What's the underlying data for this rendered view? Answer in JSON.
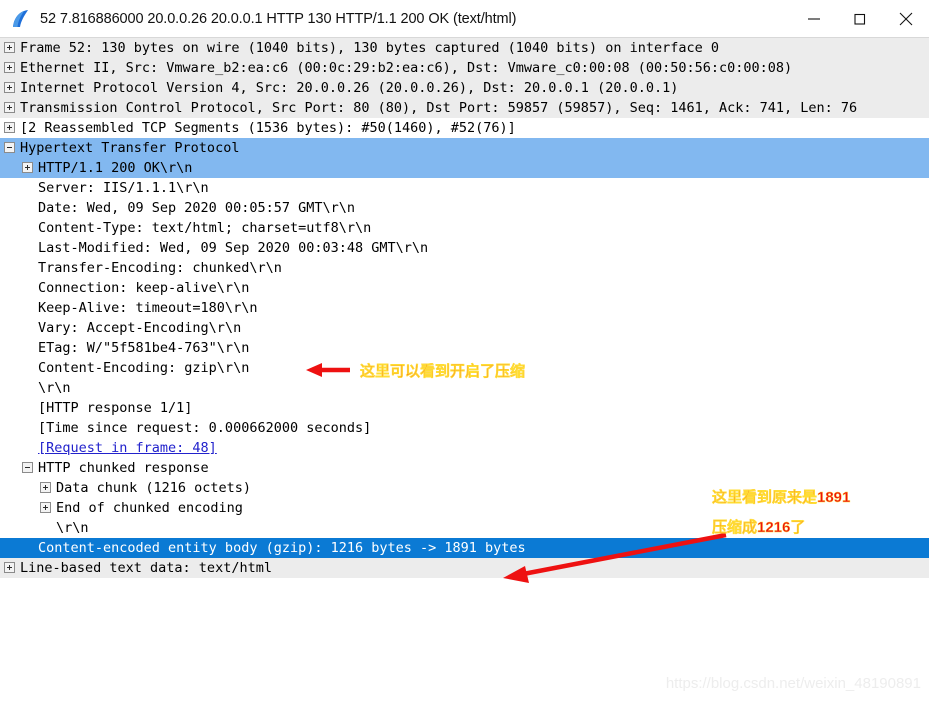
{
  "window": {
    "title": "52 7.816886000 20.0.0.26 20.0.0.1 HTTP 130 HTTP/1.1 200 OK  (text/html)",
    "icon": "wireshark-shark-fin-icon",
    "minimize_label": "—",
    "maximize_label": "□",
    "close_label": "✕"
  },
  "colors": {
    "highlight_row": "#82b8f0",
    "selected_row": "#0b7ad4",
    "alt_row": "#ececec",
    "annotation_red": "#ee1111",
    "link_blue": "#2222cc"
  },
  "tree": {
    "rows": [
      {
        "text": "Frame 52: 130 bytes on wire (1040 bits), 130 bytes captured (1040 bits) on interface 0",
        "indent": 0,
        "expander": "plus",
        "bg": "alt"
      },
      {
        "text": "Ethernet II, Src: Vmware_b2:ea:c6 (00:0c:29:b2:ea:c6), Dst: Vmware_c0:00:08 (00:50:56:c0:00:08)",
        "indent": 0,
        "expander": "plus",
        "bg": "alt"
      },
      {
        "text": "Internet Protocol Version 4, Src: 20.0.0.26 (20.0.0.26), Dst: 20.0.0.1 (20.0.0.1)",
        "indent": 0,
        "expander": "plus",
        "bg": "alt"
      },
      {
        "text": "Transmission Control Protocol, Src Port: 80 (80), Dst Port: 59857 (59857), Seq: 1461, Ack: 741, Len: 76",
        "indent": 0,
        "expander": "plus",
        "bg": "alt"
      },
      {
        "text": "[2 Reassembled TCP Segments (1536 bytes): #50(1460), #52(76)]",
        "indent": 0,
        "expander": "plus",
        "bg": "white"
      },
      {
        "text": "Hypertext Transfer Protocol",
        "indent": 0,
        "expander": "minus",
        "bg": "hl"
      },
      {
        "text": "HTTP/1.1 200 OK\\r\\n",
        "indent": 1,
        "expander": "plus",
        "bg": "hl"
      },
      {
        "text": "Server: IIS/1.1.1\\r\\n",
        "indent": 1,
        "expander": "none",
        "bg": "white"
      },
      {
        "text": "Date: Wed, 09 Sep 2020 00:05:57 GMT\\r\\n",
        "indent": 1,
        "expander": "none",
        "bg": "white"
      },
      {
        "text": "Content-Type: text/html; charset=utf8\\r\\n",
        "indent": 1,
        "expander": "none",
        "bg": "white"
      },
      {
        "text": "Last-Modified: Wed, 09 Sep 2020 00:03:48 GMT\\r\\n",
        "indent": 1,
        "expander": "none",
        "bg": "white"
      },
      {
        "text": "Transfer-Encoding: chunked\\r\\n",
        "indent": 1,
        "expander": "none",
        "bg": "white"
      },
      {
        "text": "Connection: keep-alive\\r\\n",
        "indent": 1,
        "expander": "none",
        "bg": "white"
      },
      {
        "text": "Keep-Alive: timeout=180\\r\\n",
        "indent": 1,
        "expander": "none",
        "bg": "white"
      },
      {
        "text": "Vary: Accept-Encoding\\r\\n",
        "indent": 1,
        "expander": "none",
        "bg": "white"
      },
      {
        "text": "ETag: W/\"5f581be4-763\"\\r\\n",
        "indent": 1,
        "expander": "none",
        "bg": "white"
      },
      {
        "text": "Content-Encoding: gzip\\r\\n",
        "indent": 1,
        "expander": "none",
        "bg": "white"
      },
      {
        "text": "\\r\\n",
        "indent": 1,
        "expander": "none",
        "bg": "white"
      },
      {
        "text": "[HTTP response 1/1]",
        "indent": 1,
        "expander": "none",
        "bg": "white"
      },
      {
        "text": "[Time since request: 0.000662000 seconds]",
        "indent": 1,
        "expander": "none",
        "bg": "white"
      },
      {
        "text": "[Request in frame: 48]",
        "indent": 1,
        "expander": "none",
        "bg": "white",
        "style": "link"
      },
      {
        "text": "HTTP chunked response",
        "indent": 1,
        "expander": "minus",
        "bg": "white"
      },
      {
        "text": "Data chunk (1216 octets)",
        "indent": 2,
        "expander": "plus",
        "bg": "white"
      },
      {
        "text": "End of chunked encoding",
        "indent": 2,
        "expander": "plus",
        "bg": "white"
      },
      {
        "text": "\\r\\n",
        "indent": 2,
        "expander": "none",
        "bg": "white"
      },
      {
        "text": "Content-encoded entity body (gzip): 1216 bytes -> 1891 bytes",
        "indent": 1,
        "expander": "none",
        "bg": "sel"
      },
      {
        "text": "Line-based text data: text/html",
        "indent": 0,
        "expander": "plus",
        "bg": "alt"
      }
    ]
  },
  "annotations": {
    "top": {
      "text": "这里可以看到开启了压缩",
      "arrow": "left-arrow-icon"
    },
    "bottom_line1": "这里看到原来是1891",
    "bottom_line2": "压缩成1216了",
    "bottom_arrow": "diagonal-arrow-icon"
  },
  "watermark": {
    "text": "https://blog.csdn.net/weixin_48190891"
  }
}
